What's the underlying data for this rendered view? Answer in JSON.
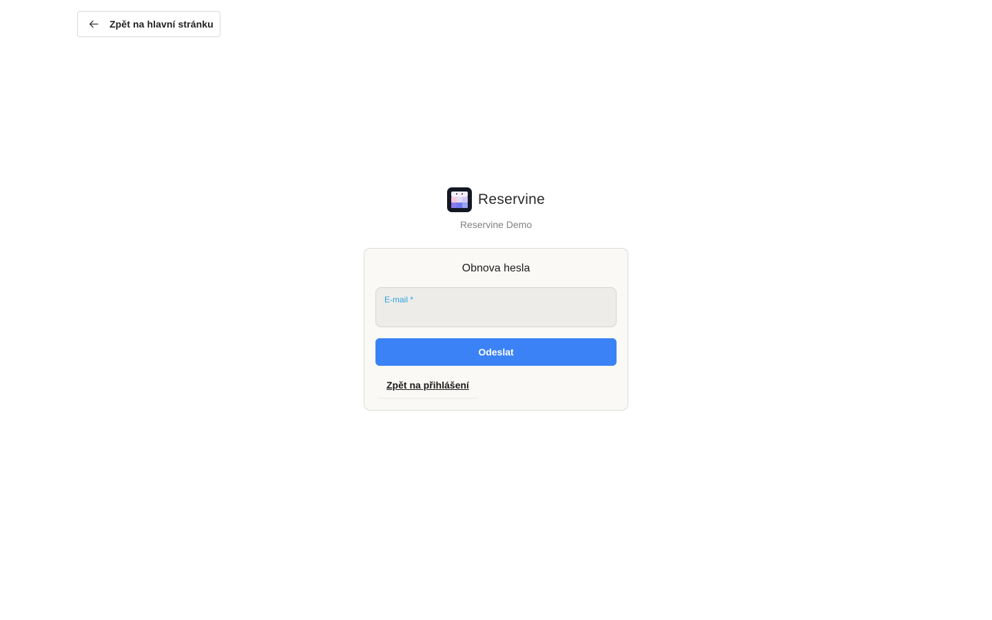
{
  "header": {
    "back_home_label": "Zpět na hlavní stránku"
  },
  "brand": {
    "name": "Reservine",
    "subtitle": "Reservine Demo"
  },
  "form": {
    "title": "Obnova hesla",
    "email_label": "E-mail *",
    "email_value": "",
    "submit_label": "Odeslat",
    "back_to_login_label": "Zpět na přihlášení"
  },
  "colors": {
    "accent": "#3b82f6",
    "label_accent": "#2aa3e0",
    "card_background": "#faf9f6",
    "logo_background": "#141824"
  },
  "icons": {
    "back": "arrow-left-icon",
    "logo": "reservine-logo-icon"
  }
}
